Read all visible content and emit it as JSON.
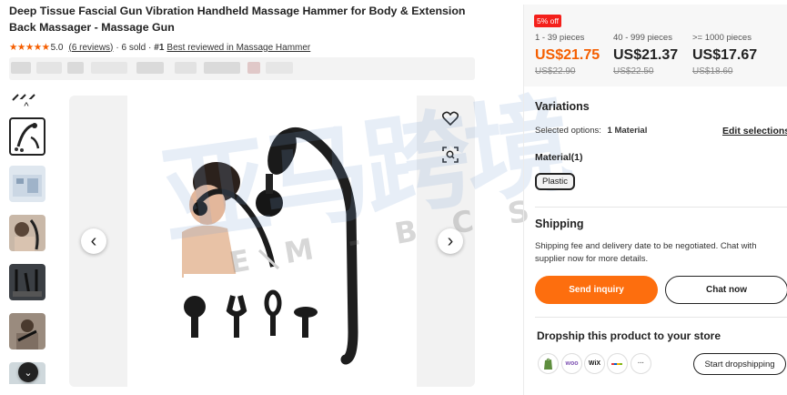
{
  "product": {
    "title": "Deep Tissue Fascial Gun Vibration Handheld Massage Hammer for Body & Extension Back Massager - Massage Gun",
    "stars": "★★★★★",
    "rating": "5.0",
    "reviews_link": "(6 reviews)",
    "sold": "· 6 sold ·",
    "rank": "#1",
    "rank_link": "Best reviewed in Massage Hammer"
  },
  "gallery": {
    "prev_arrow": "‹",
    "next_arrow": "›",
    "thumb_up": "^",
    "thumb_down": "⌄"
  },
  "pricing": {
    "discount_badge": "5% off",
    "tiers": [
      {
        "qty": "1 - 39 pieces",
        "price": "US$21.75",
        "old": "US$22.90"
      },
      {
        "qty": "40 - 999 pieces",
        "price": "US$21.37",
        "old": "US$22.50"
      },
      {
        "qty": ">= 1000 pieces",
        "price": "US$17.67",
        "old": "US$18.60"
      }
    ],
    "highlight_color": "#f55e00"
  },
  "variations": {
    "title": "Variations",
    "selected_label": "Selected options:",
    "selected_value": "1 Material",
    "edit_link": "Edit selections",
    "material_title": "Material(1)",
    "material_option": "Plastic"
  },
  "shipping": {
    "title": "Shipping",
    "text": "Shipping fee and delivery date to be negotiated. Chat with supplier now for more details."
  },
  "actions": {
    "send_inquiry": "Send inquiry",
    "chat_now": "Chat now",
    "accent": "#fd6e0e"
  },
  "dropship": {
    "title": "Dropship this product to your store",
    "platforms": [
      "shopify-icon",
      "woo",
      "WiX",
      "ebay-icon",
      "···"
    ],
    "button": "Start dropshipping"
  },
  "watermark": {
    "main": "亚马跨境",
    "sub": "E M - B C S"
  }
}
